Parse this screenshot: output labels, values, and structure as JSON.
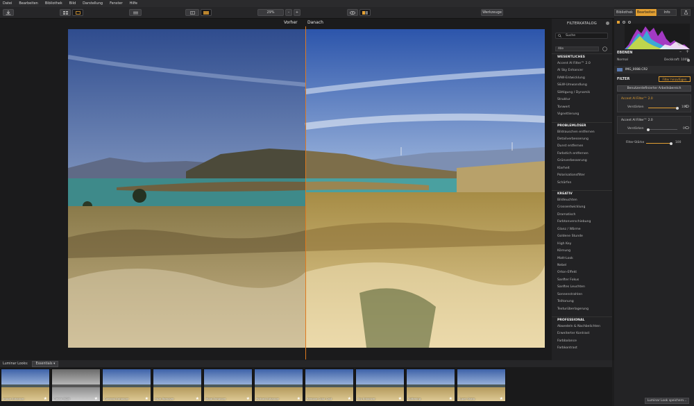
{
  "menu": [
    "Datei",
    "Bearbeiten",
    "Bibliothek",
    "Bild",
    "Darstellung",
    "Fenster",
    "Hilfe"
  ],
  "toolbar": {
    "zoom": "29%",
    "zoom_minus": "–",
    "zoom_plus": "+",
    "tools": "Werkzeuge"
  },
  "compare": {
    "before": "Vorher",
    "after": "Danach"
  },
  "catalog": {
    "title": "FILTERKATALOG",
    "search_placeholder": "Suche",
    "filter_select": "Alle",
    "sections": [
      {
        "name": "WESENTLICHES",
        "items": [
          "Accent AI Filter™ 2.0",
          "AI Sky Enhancer",
          "RAW-Entwicklung",
          "S&W-Umwandlung",
          "Sättigung / Dynamik",
          "Struktur",
          "Tonwert",
          "Vignettierung"
        ]
      },
      {
        "name": "PROBLEMLÖSER",
        "items": [
          "Bildrauschen entfernen",
          "Detailverbesserung",
          "Dunst entfernen",
          "Farbstich entfernen",
          "Grünverbesserung",
          "Klarheit",
          "Polarisationsfilter",
          "Schärfen"
        ]
      },
      {
        "name": "KREATIV",
        "items": [
          "Bildleuchten",
          "Crossentwicklung",
          "Dramatisch",
          "Farbtonverschiebung",
          "Glanz / Wärme",
          "Goldene Stunde",
          "High Key",
          "Körnung",
          "Matt-Look",
          "Nebel",
          "Orton-Effekt",
          "Sanfter Fokus",
          "Sanftes Leuchten",
          "Sonnenstrahlen",
          "Teiltonung",
          "Texturüberlagerung"
        ]
      },
      {
        "name": "PROFESSIONAL",
        "items": [
          "Abwedeln & Nachbelichten",
          "Erweiterter Kontrast",
          "Farbbalance",
          "Farbkontrast"
        ]
      }
    ]
  },
  "right": {
    "tabs": [
      "Bibliothek",
      "Bearbeiten",
      "Info"
    ],
    "active_tab": "Bearbeiten",
    "layers_heading": "EBENEN",
    "blend_mode": "Normal",
    "opacity": "Deckkraft: 100%",
    "layer_name": "IMG_0088.CR2",
    "filter_heading": "FILTER",
    "add_filter": "Filter hinzufügen",
    "workspace": "Benutzerdefinierter Arbeitsbereich",
    "filters": [
      {
        "name": "Accent AI Filter™ 2.0",
        "slider_label": "Verstärken",
        "value": "100",
        "level": 1.0
      },
      {
        "name": "Accent AI Filter™ 2.0",
        "slider_label": "Verstärken",
        "value": "0",
        "level": 0.0
      }
    ],
    "strength_label": "Filter-Stärke",
    "strength_value": "100",
    "strength_level": 1.0,
    "save_look": "Luminar Look speichern..."
  },
  "looks": {
    "heading": "Luminar Looks:",
    "category": "Essentials",
    "items": [
      "Image Enhancer",
      "Classic B&W",
      "Contrast Enhancer",
      "Haze Remover",
      "Mood Enhancer",
      "Portrait Enhancer",
      "Remove Color Cast",
      "Sky Enhancer",
      "Softening",
      "Super Sharp"
    ]
  },
  "colors": {
    "accent": "#e3a033",
    "split_line": "#e07a1f"
  }
}
